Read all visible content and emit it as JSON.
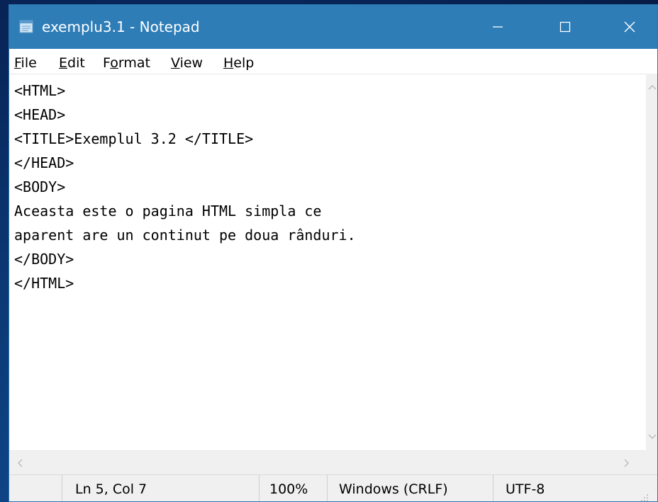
{
  "window": {
    "title": "exemplu3.1 - Notepad",
    "colors": {
      "titlebar": "#2e7db7",
      "background": "#0b3470"
    }
  },
  "titlebar_buttons": {
    "minimize": "minimize-icon",
    "maximize": "maximize-icon",
    "close": "close-icon"
  },
  "menu": [
    {
      "key": "F",
      "rest": "ile"
    },
    {
      "key": "E",
      "rest": "dit"
    },
    {
      "pre": "F",
      "key": "o",
      "rest": "rmat"
    },
    {
      "key": "V",
      "rest": "iew"
    },
    {
      "key": "H",
      "rest": "elp"
    }
  ],
  "editor": {
    "lines": [
      "<HTML>",
      "<HEAD>",
      "<TITLE>Exemplul 3.2 </TITLE>",
      "</HEAD>",
      "<BODY>",
      "Aceasta este o pagina HTML simpla ce",
      "aparent are un continut pe doua rânduri.",
      "</BODY>",
      "</HTML>"
    ]
  },
  "scrollbar_icons": {
    "up": "chevron-up-icon",
    "down": "chevron-down-icon",
    "left": "chevron-left-icon",
    "right": "chevron-right-icon"
  },
  "status": {
    "position": "Ln 5, Col 7",
    "zoom": "100%",
    "line_ending": "Windows (CRLF)",
    "encoding": "UTF-8"
  }
}
